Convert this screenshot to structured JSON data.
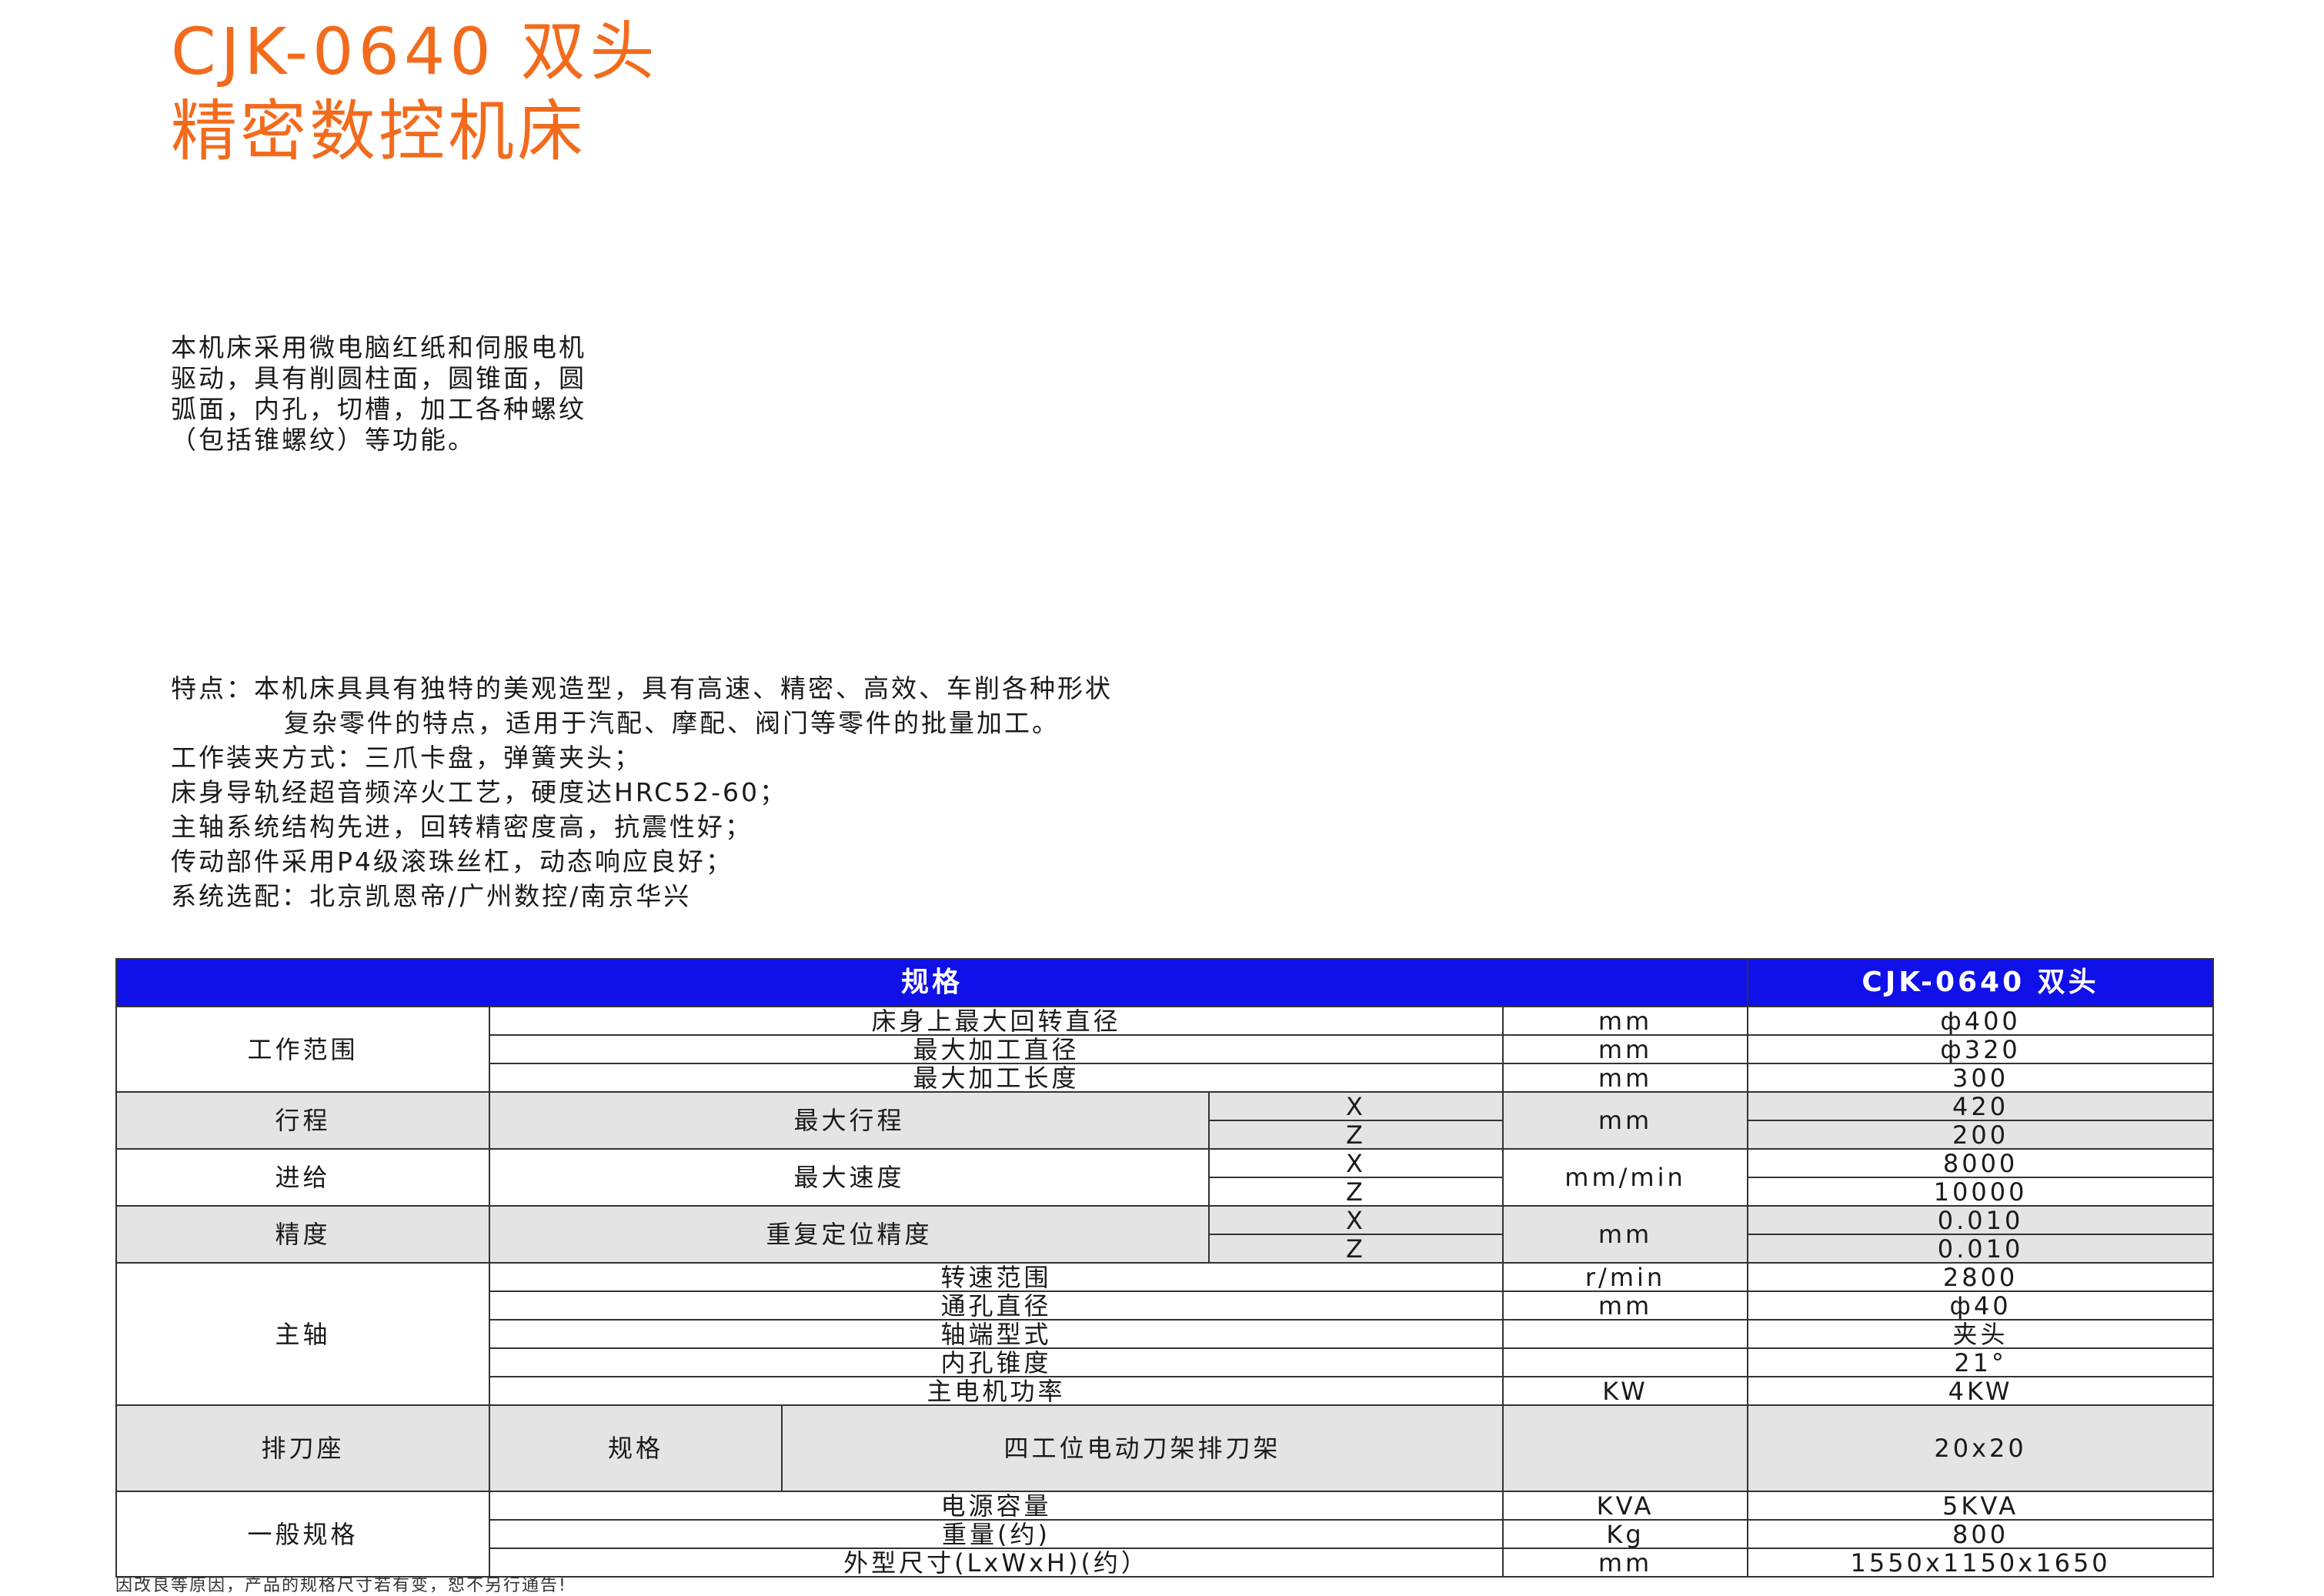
{
  "title": {
    "line1": "CJK-0640 双头",
    "line2": "精密数控机床"
  },
  "intro": [
    "本机床采用微电脑红纸和伺服电机",
    "驱动，具有削圆柱面，圆锥面，圆",
    "弧面，内孔，切槽，加工各种螺纹",
    "（包括锥螺纹）等功能。"
  ],
  "features": [
    "特点：本机床具具有独特的美观造型，具有高速、精密、高效、车削各种形状",
    "复杂零件的特点，适用于汽配、摩配、阀门等零件的批量加工。",
    "工作装夹方式：三爪卡盘，弹簧夹头；",
    "床身导轨经超音频淬火工艺，硬度达HRC52-60；",
    "主轴系统结构先进，回转精密度高，抗震性好；",
    "传动部件采用P4级滚珠丝杠，动态响应良好；",
    "系统选配：北京凯恩帝/广州数控/南京华兴"
  ],
  "table": {
    "header_spec": "规格",
    "header_model": "CJK-0640 双头",
    "work_range": {
      "group": "工作范围",
      "rows": [
        {
          "item": "床身上最大回转直径",
          "unit": "mm",
          "value": "ф400"
        },
        {
          "item": "最大加工直径",
          "unit": "mm",
          "value": "ф320"
        },
        {
          "item": "最大加工长度",
          "unit": "mm",
          "value": "300"
        }
      ]
    },
    "travel": {
      "group": "行程",
      "item": "最大行程",
      "axis_x": "X",
      "axis_z": "Z",
      "unit": "mm",
      "value_x": "420",
      "value_z": "200"
    },
    "feed": {
      "group": "进给",
      "item": "最大速度",
      "axis_x": "X",
      "axis_z": "Z",
      "unit": "mm/min",
      "value_x": "8000",
      "value_z": "10000"
    },
    "precision": {
      "group": "精度",
      "item": "重复定位精度",
      "axis_x": "X",
      "axis_z": "Z",
      "unit": "mm",
      "value_x": "0.010",
      "value_z": "0.010"
    },
    "spindle": {
      "group": "主轴",
      "rows": [
        {
          "item": "转速范围",
          "unit": "r/min",
          "value": "2800"
        },
        {
          "item": "通孔直径",
          "unit": "mm",
          "value": "ф40"
        },
        {
          "item": "轴端型式",
          "unit": "",
          "value": "夹头"
        },
        {
          "item": "内孔锥度",
          "unit": "",
          "value": "21°"
        },
        {
          "item": "主电机功率",
          "unit": "KW",
          "value": "4KW"
        }
      ]
    },
    "tool_post": {
      "group": "排刀座",
      "sub": "规格",
      "item": "四工位电动刀架排刀架",
      "unit": "",
      "value": "20x20"
    },
    "general": {
      "group": "一般规格",
      "rows": [
        {
          "item": "电源容量",
          "unit": "KVA",
          "value": "5KVA"
        },
        {
          "item": "重量(约)",
          "unit": "Kg",
          "value": "800"
        },
        {
          "item": "外型尺寸(LxWxH)(约）",
          "unit": "mm",
          "value": "1550x1150x1650"
        }
      ]
    }
  },
  "notice": "因改良等原因，产品的规格尺寸若有变，恕不另行通告!"
}
